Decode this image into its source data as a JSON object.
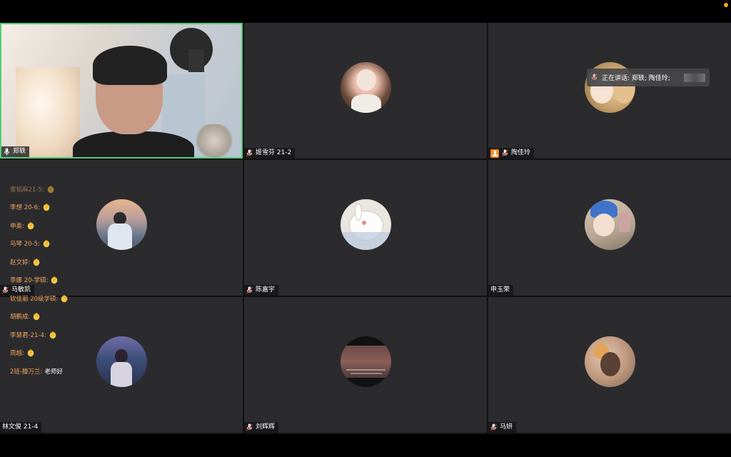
{
  "meeting": {
    "speaking_prefix": "正在讲话: 郑轶; 陶佳玲;",
    "accent_active": "#4fd078",
    "chat_name_color": "#f0a55a"
  },
  "participants": [
    {
      "name": "郑轶",
      "mic": "mic-on",
      "video": true
    },
    {
      "name": "姬雪芬 21-2",
      "mic": "mic-muted"
    },
    {
      "name": "陶佳玲",
      "mic": "mic-muted",
      "host": true
    },
    {
      "name": "马敏凯",
      "mic": "mic-muted"
    },
    {
      "name": "陈嘉宇",
      "mic": "mic-muted"
    },
    {
      "name": "申玉荣",
      "mic": "none"
    },
    {
      "name": "林文俊 21-4",
      "mic": "none"
    },
    {
      "name": "刘辉辉",
      "mic": "mic-muted"
    },
    {
      "name": "马妍",
      "mic": "mic-muted"
    }
  ],
  "chat": [
    {
      "name": "雷韬麻21-5:",
      "emoji": "clap"
    },
    {
      "name": "李想 20-6:",
      "emoji": "clap"
    },
    {
      "name": "申奥:",
      "emoji": "clap"
    },
    {
      "name": "马琴 20-5:",
      "emoji": "clap"
    },
    {
      "name": "赵文婷:",
      "emoji": "clap"
    },
    {
      "name": "李娜 20-学硕:",
      "emoji": "clap"
    },
    {
      "name": "钦佳丽 20级学硕:",
      "emoji": "clap"
    },
    {
      "name": "胡鹏成:",
      "emoji": "clap"
    },
    {
      "name": "李慧君-21-4:",
      "emoji": "clap"
    },
    {
      "name": "周越:",
      "emoji": "clap"
    },
    {
      "name": "2班-滕万兰:",
      "text": "老师好"
    }
  ]
}
